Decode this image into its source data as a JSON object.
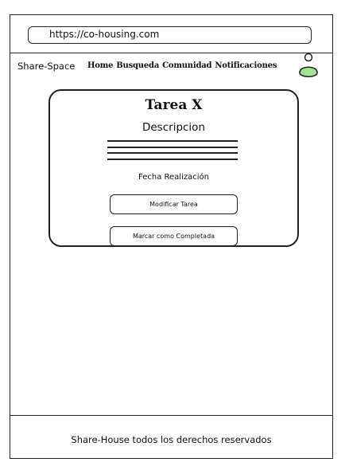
{
  "browser": {
    "url": "https://co-housing.com"
  },
  "header": {
    "brand": "Share-Space",
    "nav": [
      "Home",
      "Busqueda",
      "Comunidad",
      "Notificaciones"
    ],
    "avatar_icon": "user-avatar-icon"
  },
  "task_card": {
    "title": "Tarea X",
    "description_label": "Descripcion",
    "date_label": "Fecha Realización",
    "edit_button": "Modificar Tarea",
    "complete_button": "Marcar como Completada"
  },
  "footer": {
    "text": "Share-House todos los derechos reservados"
  },
  "colors": {
    "stroke": "#222222",
    "avatar_fill": "#a3e391"
  }
}
